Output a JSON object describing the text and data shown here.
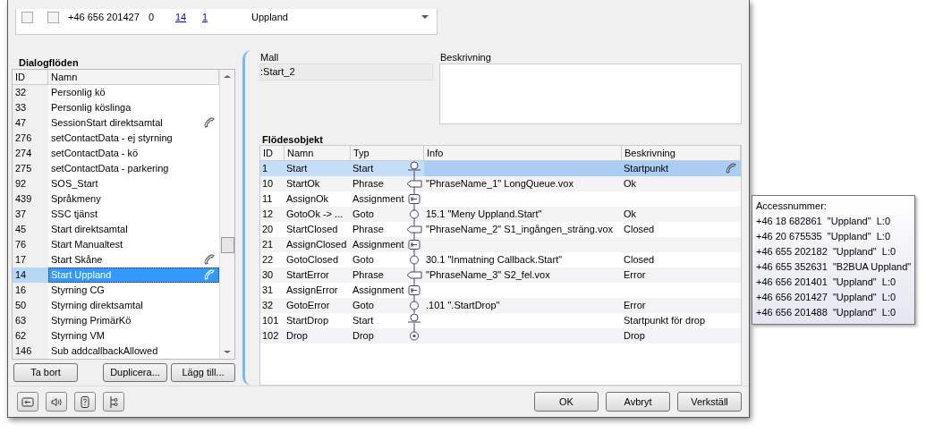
{
  "top_table": {
    "rows": [
      {
        "checked_1": false,
        "checked_2": false,
        "number": "+46 656 201427",
        "column_2": "0",
        "column_3": "14",
        "column_4": "1",
        "name": "Uppland"
      }
    ]
  },
  "dialog_flows": {
    "title": "Dialogflöden",
    "columns": [
      "ID",
      "Namn"
    ],
    "rows": [
      {
        "id": "32",
        "name": "Personlig kö",
        "phone": false,
        "selected": false
      },
      {
        "id": "33",
        "name": "Personlig köslinga",
        "phone": false,
        "selected": false
      },
      {
        "id": "47",
        "name": "SessionStart direktsamtal",
        "phone": true,
        "selected": false
      },
      {
        "id": "276",
        "name": "setContactData - ej styrning",
        "phone": false,
        "selected": false
      },
      {
        "id": "274",
        "name": "setContactData - kö",
        "phone": false,
        "selected": false
      },
      {
        "id": "275",
        "name": "setContactData - parkering",
        "phone": false,
        "selected": false
      },
      {
        "id": "92",
        "name": "SOS_Start",
        "phone": false,
        "selected": false
      },
      {
        "id": "439",
        "name": "Språkmeny",
        "phone": false,
        "selected": false
      },
      {
        "id": "37",
        "name": "SSC tjänst",
        "phone": false,
        "selected": false
      },
      {
        "id": "45",
        "name": "Start direktsamtal",
        "phone": false,
        "selected": false
      },
      {
        "id": "76",
        "name": "Start Manualtest",
        "phone": false,
        "selected": false
      },
      {
        "id": "17",
        "name": "Start Skåne",
        "phone": true,
        "selected": false
      },
      {
        "id": "14",
        "name": "Start Uppland",
        "phone": true,
        "selected": true
      },
      {
        "id": "16",
        "name": "Styrning CG",
        "phone": false,
        "selected": false
      },
      {
        "id": "50",
        "name": "Styrning direktsamtal",
        "phone": false,
        "selected": false
      },
      {
        "id": "63",
        "name": "Styrning PrimärKö",
        "phone": false,
        "selected": false
      },
      {
        "id": "62",
        "name": "Styrning VM",
        "phone": false,
        "selected": false
      },
      {
        "id": "146",
        "name": "Sub addcallbackAllowed",
        "phone": false,
        "selected": false
      }
    ],
    "buttons": [
      "Ta bort",
      "Duplicera...",
      "Lägg till..."
    ]
  },
  "template": {
    "label": "Mall",
    "value": ":Start_2"
  },
  "description": {
    "label": "Beskrivning"
  },
  "flow_objects": {
    "title": "Flödesobjekt",
    "columns": [
      "ID",
      "Namn",
      "Typ",
      "Info",
      "Beskrivning"
    ],
    "rows": [
      {
        "id": "1",
        "name": "Start",
        "type": "Start",
        "kind": "start",
        "description": "Startpunkt",
        "phone": true,
        "selected": true
      },
      {
        "id": "10",
        "name": "StartOk",
        "type": "Phrase",
        "kind": "phrase",
        "info": "\"PhraseName_1\" LongQueue.vox",
        "description": "Ok",
        "phone": false,
        "selected": false
      },
      {
        "id": "11",
        "name": "AssignOk",
        "type": "Assignment",
        "kind": "assignment",
        "phone": false,
        "selected": false
      },
      {
        "id": "12",
        "name": "GotoOk -> ...",
        "type": "Goto",
        "kind": "goto",
        "info": "15.1 \"Meny Uppland.Start\"",
        "description": "Ok",
        "phone": false,
        "selected": false
      },
      {
        "id": "20",
        "name": "StartClosed",
        "type": "Phrase",
        "kind": "phrase",
        "info": "\"PhraseName_2\" S1_ingången_sträng.vox",
        "description": "Closed",
        "phone": false,
        "selected": false
      },
      {
        "id": "21",
        "name": "AssignClosed",
        "type": "Assignment",
        "kind": "assignment",
        "phone": false,
        "selected": false
      },
      {
        "id": "22",
        "name": "GotoClosed",
        "type": "Goto",
        "kind": "goto",
        "info": "30.1 \"Inmatning Callback.Start\"",
        "description": "Closed",
        "phone": false,
        "selected": false
      },
      {
        "id": "30",
        "name": "StartError",
        "type": "Phrase",
        "kind": "phrase",
        "info": "\"PhraseName_3\" S2_fel.vox",
        "description": "Error",
        "phone": false,
        "selected": false
      },
      {
        "id": "31",
        "name": "AssignError",
        "type": "Assignment",
        "kind": "assignment",
        "phone": false,
        "selected": false
      },
      {
        "id": "32",
        "name": "GotoError",
        "type": "Goto",
        "kind": "goto",
        "info": ".101 \".StartDrop\"",
        "description": "Error",
        "phone": false,
        "selected": false
      },
      {
        "id": "101",
        "name": "StartDrop",
        "type": "Start",
        "kind": "start",
        "description": "Startpunkt för drop",
        "phone": false,
        "selected": false
      },
      {
        "id": "102",
        "name": "Drop",
        "type": "Drop",
        "kind": "drop",
        "description": "Drop",
        "phone": false,
        "selected": false
      }
    ]
  },
  "tooltip": {
    "title": "Accessnummer:",
    "lines": [
      "+46 18 682861  \"Uppland\"  L:0",
      "+46 20 675535  \"Uppland\"  L:0",
      "+46 655 202182  \"Uppland\"  L:0",
      "+46 655 352631  \"B2BUA Uppland\"",
      "+46 656 201401  \"Uppland\"  L:0",
      "+46 656 201427  \"Uppland\"  L:0",
      "+46 656 201488  \"Uppland\"  L:0"
    ]
  },
  "footer_buttons": [
    "OK",
    "Avbryt",
    "Verkställ"
  ]
}
